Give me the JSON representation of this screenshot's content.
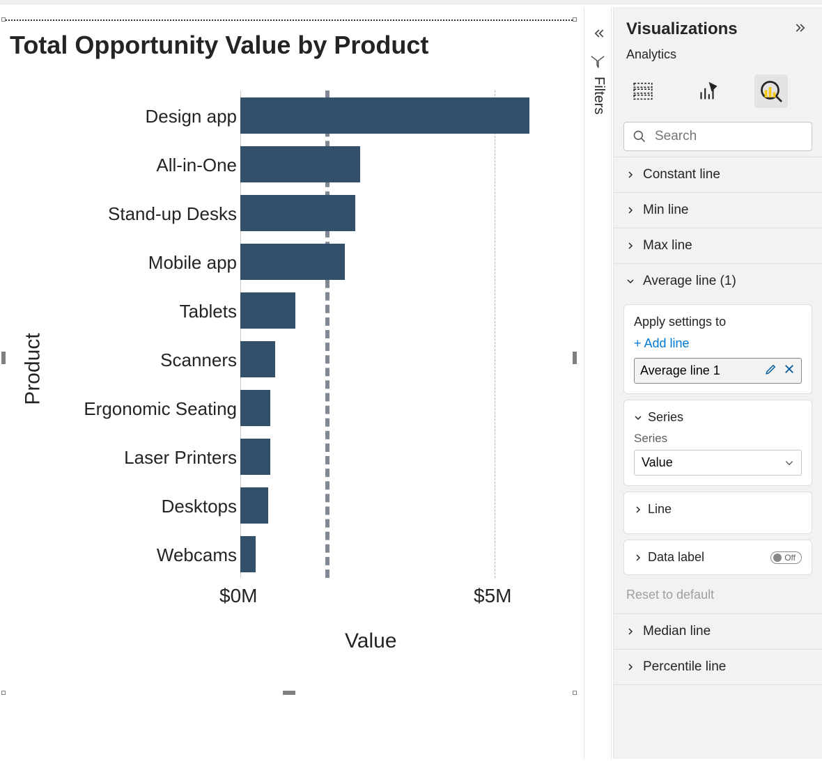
{
  "chart_data": {
    "type": "bar",
    "orientation": "horizontal",
    "title": "Total Opportunity Value by Product",
    "xlabel": "Value",
    "ylabel": "Product",
    "x_ticks": [
      "$0M",
      "$5M"
    ],
    "x_tick_values": [
      0,
      5
    ],
    "xlim": [
      0,
      6
    ],
    "categories": [
      "Design app",
      "All-in-One",
      "Stand-up Desks",
      "Mobile app",
      "Tablets",
      "Scanners",
      "Ergonomic Seating",
      "Laser Printers",
      "Desktops",
      "Webcams"
    ],
    "values": [
      5.8,
      2.4,
      2.3,
      2.1,
      1.1,
      0.7,
      0.6,
      0.6,
      0.55,
      0.3
    ],
    "reference_lines": [
      {
        "name": "Average line 1",
        "value": 1.65,
        "style": "dashed",
        "color": "#7f8894"
      }
    ],
    "bar_color": "#33506b"
  },
  "filters": {
    "label": "Filters"
  },
  "viz_pane": {
    "title": "Visualizations",
    "subtitle": "Analytics",
    "search_placeholder": "Search",
    "sections": {
      "constant": "Constant line",
      "min": "Min line",
      "max": "Max line",
      "average": "Average line (1)",
      "median": "Median line",
      "percentile": "Percentile line"
    },
    "avg_card": {
      "apply_label": "Apply settings to",
      "add_link": "+ Add line",
      "item_name": "Average line 1"
    },
    "series_card": {
      "head": "Series",
      "field_label": "Series",
      "value": "Value"
    },
    "line_card": {
      "head": "Line"
    },
    "data_label_card": {
      "head": "Data label",
      "toggle": "Off"
    },
    "reset": "Reset to default"
  }
}
